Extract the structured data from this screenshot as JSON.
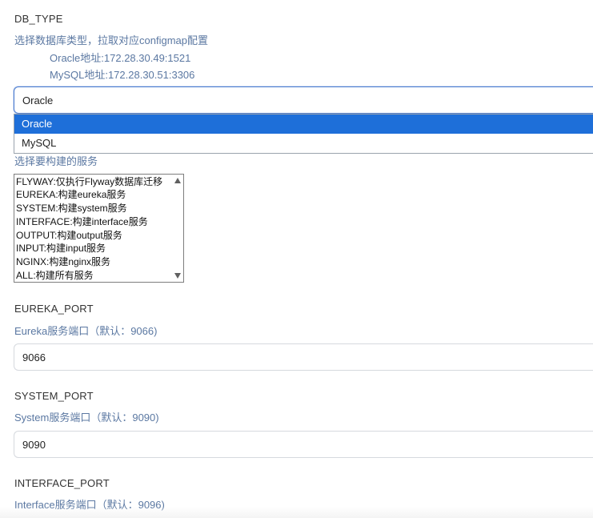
{
  "db_type": {
    "name": "DB_TYPE",
    "description": "选择数据库类型，拉取对应configmap配置",
    "addresses": [
      "Oracle地址:172.28.30.49:1521",
      "MySQL地址:172.28.30.51:3306"
    ],
    "selected_value": "Oracle",
    "options": [
      "Oracle",
      "MySQL"
    ],
    "highlighted_option": "Oracle"
  },
  "services": {
    "description": "选择要构建的服务",
    "options": [
      "FLYWAY:仅执行Flyway数据库迁移",
      "EUREKA:构建eureka服务",
      "SYSTEM:构建system服务",
      "INTERFACE:构建interface服务",
      "OUTPUT:构建output服务",
      "INPUT:构建input服务",
      "NGINX:构建nginx服务",
      "ALL:构建所有服务"
    ]
  },
  "eureka_port": {
    "name": "EUREKA_PORT",
    "description": "Eureka服务端口（默认：9066)",
    "value": "9066"
  },
  "system_port": {
    "name": "SYSTEM_PORT",
    "description": "System服务端口（默认：9090)",
    "value": "9090"
  },
  "interface_port": {
    "name": "INTERFACE_PORT",
    "description": "Interface服务端口（默认：9096)"
  },
  "colors": {
    "description_text": "#5b78a2",
    "selected_option_bg": "#1e6fd9",
    "focus_border": "#4a7bd0"
  },
  "icons": {
    "scroll_up": "scroll-up-arrow-icon",
    "scroll_down": "scroll-down-arrow-icon"
  }
}
